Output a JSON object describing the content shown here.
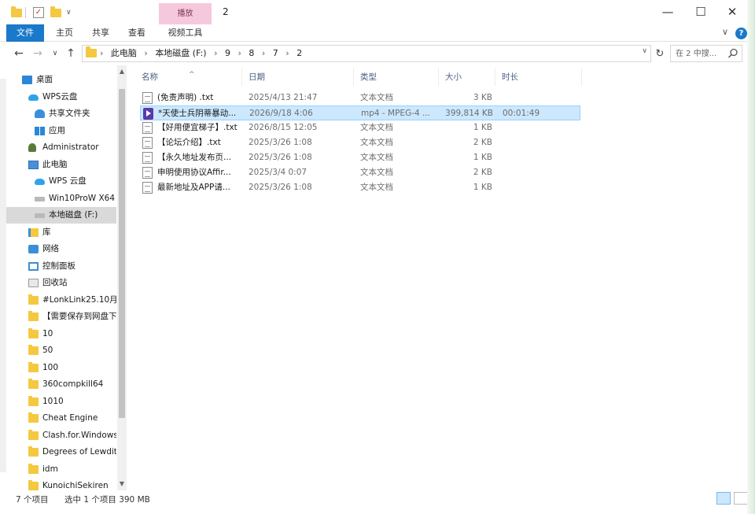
{
  "titlebar": {
    "contextual_tab": "播放",
    "title": "2",
    "qa_dropdown": "∨",
    "minimize": "—",
    "maximize": "☐",
    "close": "✕"
  },
  "ribbon": {
    "tabs": [
      "文件",
      "主页",
      "共享",
      "查看",
      "视频工具"
    ],
    "collapse": "∨",
    "help": "?"
  },
  "address": {
    "back": "←",
    "forward": "→",
    "recent": "∨",
    "up": "↑",
    "crumbs": [
      "此电脑",
      "本地磁盘 (F:)",
      "9",
      "8",
      "7",
      "2"
    ],
    "dropdown": "∨",
    "refresh": "↻",
    "search_placeholder": "在 2 中搜..."
  },
  "nav": {
    "items": [
      {
        "label": "桌面",
        "icon": "desktop-icon",
        "indent": 0
      },
      {
        "label": "WPS云盘",
        "icon": "cloud-icon",
        "indent": 1
      },
      {
        "label": "共享文件夹",
        "icon": "people-icon",
        "indent": 2
      },
      {
        "label": "应用",
        "icon": "apps-icon",
        "indent": 2
      },
      {
        "label": "Administrator",
        "icon": "user-icon",
        "indent": 1
      },
      {
        "label": "此电脑",
        "icon": "pc-icon",
        "indent": 1
      },
      {
        "label": "WPS 云盘",
        "icon": "cloud-icon",
        "indent": 2
      },
      {
        "label": "Win10ProW X64",
        "icon": "drive-icon",
        "indent": 2
      },
      {
        "label": "本地磁盘 (F:)",
        "icon": "drive-icon",
        "indent": 2,
        "selected": true
      },
      {
        "label": "库",
        "icon": "library-icon",
        "indent": 1
      },
      {
        "label": "网络",
        "icon": "network-icon",
        "indent": 1
      },
      {
        "label": "控制面板",
        "icon": "control-panel-icon",
        "indent": 1
      },
      {
        "label": "回收站",
        "icon": "recycle-bin-icon",
        "indent": 1
      },
      {
        "label": "#LonkLink25.10月-",
        "icon": "folder-icon",
        "indent": 1
      },
      {
        "label": "【需要保存到网盘下",
        "icon": "folder-icon",
        "indent": 1
      },
      {
        "label": "10",
        "icon": "folder-icon",
        "indent": 1
      },
      {
        "label": "50",
        "icon": "folder-icon",
        "indent": 1
      },
      {
        "label": "100",
        "icon": "folder-icon",
        "indent": 1
      },
      {
        "label": "360compkill64",
        "icon": "folder-icon",
        "indent": 1
      },
      {
        "label": "1010",
        "icon": "folder-icon",
        "indent": 1
      },
      {
        "label": "Cheat Engine",
        "icon": "folder-icon",
        "indent": 1
      },
      {
        "label": "Clash.for.Windows",
        "icon": "folder-icon",
        "indent": 1
      },
      {
        "label": "Degrees of Lewdit",
        "icon": "folder-icon",
        "indent": 1
      },
      {
        "label": "idm",
        "icon": "folder-icon",
        "indent": 1
      },
      {
        "label": "KunoichiSekiren",
        "icon": "folder-icon",
        "indent": 1
      }
    ],
    "scroll_up": "▲",
    "scroll_down": "▼"
  },
  "files": {
    "columns": [
      "名称",
      "日期",
      "类型",
      "大小",
      "时长"
    ],
    "sort_caret": "^",
    "rows": [
      {
        "name": "(免责声明) .txt",
        "date": "2025/4/13 21:47",
        "type": "文本文档",
        "size": "3 KB",
        "duration": "",
        "icon": "text-file-icon"
      },
      {
        "name": "*天使士兵阴蒂暴动...",
        "date": "2026/9/18 4:06",
        "type": "mp4 - MPEG-4 ...",
        "size": "399,814 KB",
        "duration": "00:01:49",
        "icon": "video-file-icon",
        "selected": true
      },
      {
        "name": "【好用便宜梯子】.txt",
        "date": "2026/8/15 12:05",
        "type": "文本文档",
        "size": "1 KB",
        "duration": "",
        "icon": "text-file-icon"
      },
      {
        "name": "【论坛介绍】.txt",
        "date": "2025/3/26 1:08",
        "type": "文本文档",
        "size": "2 KB",
        "duration": "",
        "icon": "text-file-icon"
      },
      {
        "name": "【永久地址发布页...",
        "date": "2025/3/26 1:08",
        "type": "文本文档",
        "size": "1 KB",
        "duration": "",
        "icon": "text-file-icon"
      },
      {
        "name": "申明使用协议Affir...",
        "date": "2025/3/4 0:07",
        "type": "文本文档",
        "size": "2 KB",
        "duration": "",
        "icon": "text-file-icon"
      },
      {
        "name": "最新地址及APP请...",
        "date": "2025/3/26 1:08",
        "type": "文本文档",
        "size": "1 KB",
        "duration": "",
        "icon": "text-file-icon"
      }
    ]
  },
  "status": {
    "item_count": "7 个项目",
    "selected": "选中 1 个项目  390 MB"
  },
  "colors": {
    "accent": "#1979ca",
    "selection": "#cce8ff",
    "contextual_tab": "#f6c8dd",
    "folder": "#f5c842"
  }
}
